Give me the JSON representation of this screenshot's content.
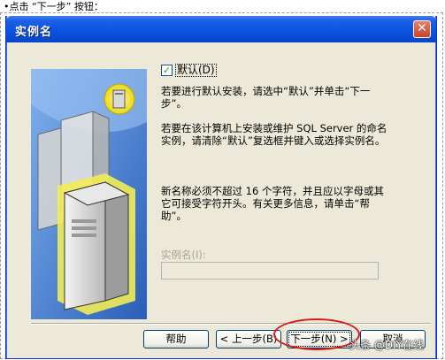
{
  "caption": "•点击 “下一步” 按钮：",
  "dialog": {
    "title": "实例名",
    "close_glyph": "✕",
    "default_checkbox": {
      "label": "默认(D)",
      "checked": true,
      "check_glyph": "✓"
    },
    "paragraphs": [
      "若要进行默认安装，请选中“默认”并单击“下一步”。",
      "若要在该计算机上安装或维护 SQL Server 的命名实例，请清除“默认”复选框并键入或选择实例名。",
      "新名称必须不超过 16 个字符，并且应以字母或其它可接受字符开头。有关更多信息，请单击“帮助”。"
    ],
    "instance_name": {
      "label": "实例名(I):",
      "value": "",
      "enabled": false
    },
    "buttons": {
      "help": "帮助",
      "back": "< 上一步(B)",
      "next": "下一步(N) >",
      "cancel": "取消"
    }
  },
  "watermark": "头条 @DIY在线",
  "colors": {
    "titlebar": "#0a52e0",
    "dialog_bg": "#ece9d8",
    "illustration_bg": "#4d8ad8",
    "highlight_circle": "#d81a1a"
  },
  "icons": {
    "illustration": "server-computers-illustration",
    "close": "close-icon",
    "check": "check-icon"
  }
}
